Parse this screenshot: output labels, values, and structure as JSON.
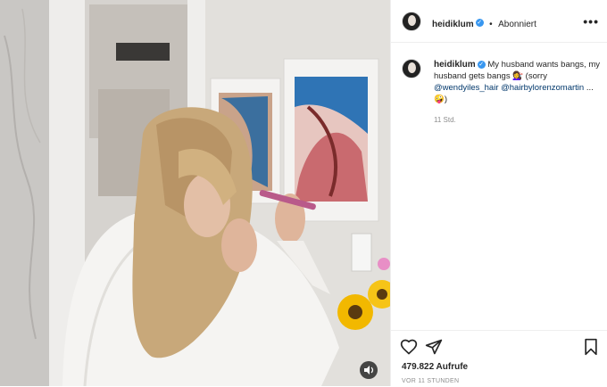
{
  "post": {
    "username": "heidiklum",
    "verified_icon": "verified-badge-icon",
    "separator": "•",
    "follow_status": "Abonniert",
    "more_icon": "more-options-icon",
    "caption_text": "My husband wants bangs, my husband gets bangs 💇‍♀️ (sorry",
    "mention_1": "@wendyiles_hair",
    "mention_2": "@hairbylorenzomartin",
    "caption_end": "...🤪)",
    "time_ago": "11 Std.",
    "views": "479.822 Aufrufe",
    "date": "VOR 11 STUNDEN"
  },
  "icons": {
    "like": "heart-icon",
    "share": "share-icon",
    "save": "bookmark-icon",
    "mute": "speaker-icon"
  },
  "colors": {
    "text": "#262626",
    "link": "#00376b",
    "muted": "#8e8e8e",
    "verified": "#3897f0"
  }
}
